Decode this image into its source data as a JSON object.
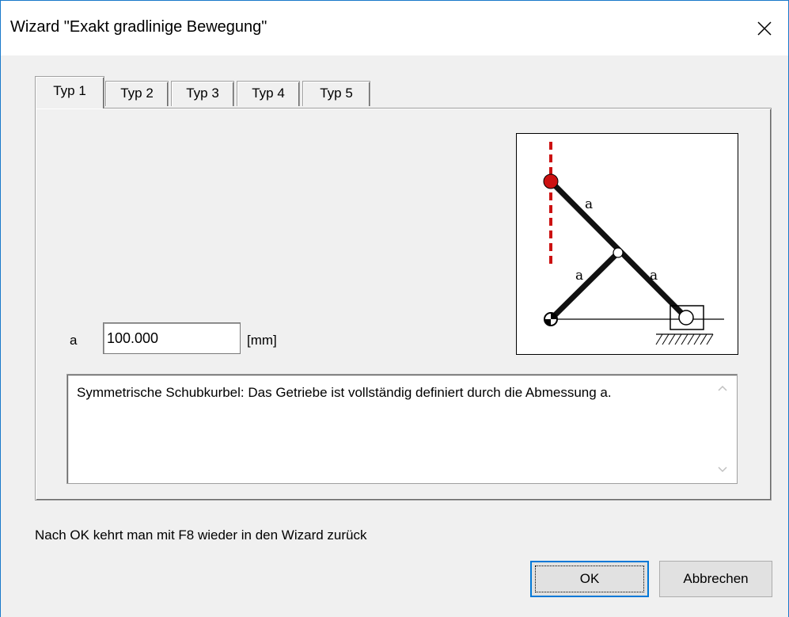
{
  "window": {
    "title": "Wizard \"Exakt gradlinige Bewegung\"",
    "close_icon": "close-icon"
  },
  "tabs": [
    {
      "label": "Typ 1",
      "active": true
    },
    {
      "label": "Typ 2",
      "active": false
    },
    {
      "label": "Typ 3",
      "active": false
    },
    {
      "label": "Typ 4",
      "active": false
    },
    {
      "label": "Typ 5",
      "active": false
    }
  ],
  "diagram": {
    "labels": [
      "a",
      "a",
      "a"
    ],
    "colors": {
      "trace": "#cc1111",
      "link": "#111111"
    }
  },
  "parameter": {
    "label": "a",
    "value": "100.000",
    "unit": "[mm]"
  },
  "description": {
    "text": "Symmetrische Schubkurbel: Das Getriebe ist vollständig definiert durch die Abmessung a."
  },
  "hint": "Nach OK kehrt man mit F8 wieder in den Wizard zurück",
  "buttons": {
    "ok_label": "OK",
    "cancel_label": "Abbrechen"
  }
}
